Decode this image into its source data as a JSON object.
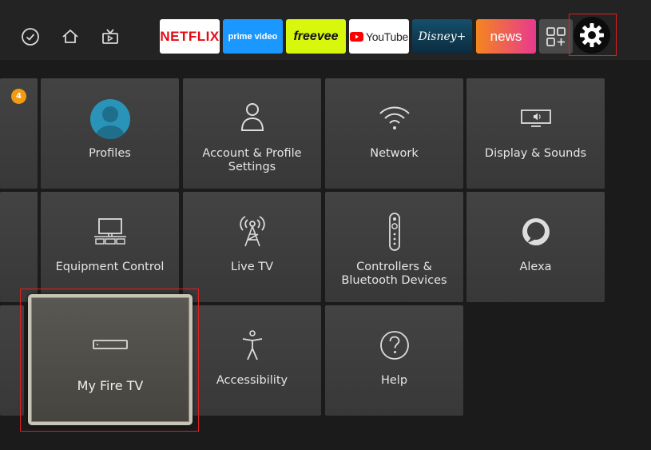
{
  "nav": {
    "icons": [
      "check-circle-icon",
      "home-icon",
      "live-tv-icon"
    ]
  },
  "apps": [
    {
      "name": "netflix",
      "label": "NETFLIX",
      "bg": "#ffffff",
      "fg": "#e50914"
    },
    {
      "name": "prime-video",
      "label": "prime video",
      "bg": "#1a98ff",
      "fg": "#ffffff"
    },
    {
      "name": "freevee",
      "label": "freevee",
      "bg": "#d7f70d",
      "fg": "#111111"
    },
    {
      "name": "youtube",
      "label": "YouTube",
      "bg": "#ffffff",
      "fg": "#222222"
    },
    {
      "name": "disney-plus",
      "label": "Disney+",
      "bg": "#0e3d55",
      "fg": "#ffffff"
    },
    {
      "name": "news",
      "label": "news",
      "bg": "#f0672a",
      "fg": "#ffffff"
    }
  ],
  "notification_count": "4",
  "settings": {
    "profiles": "Profiles",
    "account": "Account & Profile Settings",
    "network": "Network",
    "display": "Display & Sounds",
    "equipment": "Equipment Control",
    "livetv": "Live TV",
    "controllers": "Controllers & Bluetooth Devices",
    "alexa": "Alexa",
    "myfiretv": "My Fire TV",
    "accessibility": "Accessibility",
    "help": "Help"
  },
  "colors": {
    "background": "#1b1b1b",
    "topbar": "#232323",
    "tile": "#3e3e3e",
    "highlight": "#e01e1e",
    "badge": "#f19a12"
  }
}
